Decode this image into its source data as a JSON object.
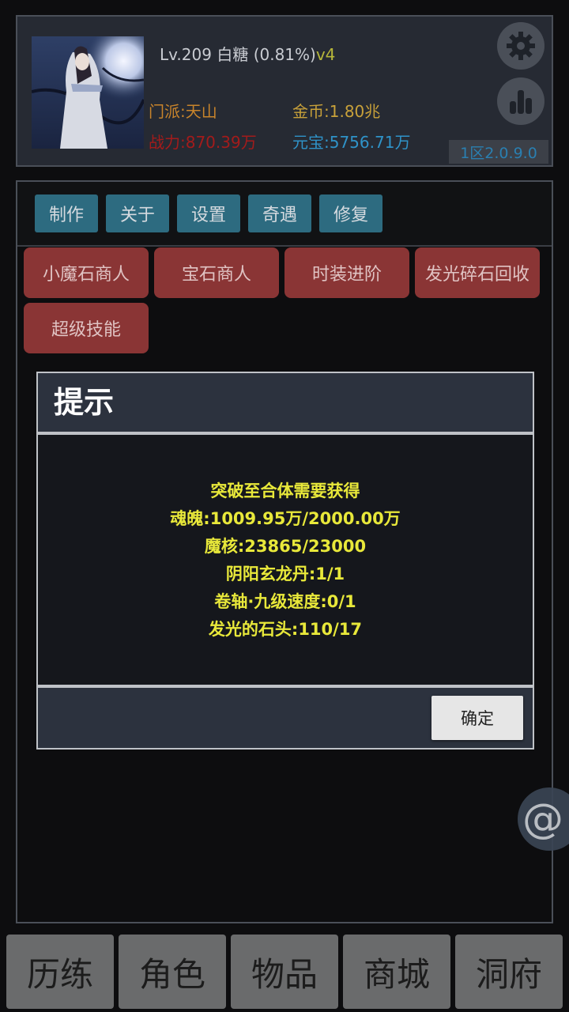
{
  "header": {
    "level": "Lv.209",
    "player_name": "白糖",
    "exp_percent": "(0.81%)",
    "vip": "v4",
    "sect": "门派:天山",
    "gold": "金币:1.80兆",
    "power": "战力:870.39万",
    "ingot": "元宝:5756.71万",
    "server": "1区2.0.9.0",
    "settings_icon": "gear-icon",
    "ranking_icon": "bar-chart-icon"
  },
  "tabs": [
    "制作",
    "关于",
    "设置",
    "奇遇",
    "修复"
  ],
  "shop_buttons": [
    "小魔石商人",
    "宝石商人",
    "时装进阶",
    "发光碎石回收",
    "超级技能"
  ],
  "dialog": {
    "title": "提示",
    "lines": [
      "突破至合体需要获得",
      "魂魄:1009.95万/2000.00万",
      "魔核:23865/23000",
      "阴阳玄龙丹:1/1",
      "卷轴·九级速度:0/1",
      "发光的石头:110/17"
    ],
    "confirm": "确定"
  },
  "float_button": {
    "symbol": "@",
    "icon": "at-icon"
  },
  "bottom_nav": [
    "历练",
    "角色",
    "物品",
    "商城",
    "洞府"
  ]
}
